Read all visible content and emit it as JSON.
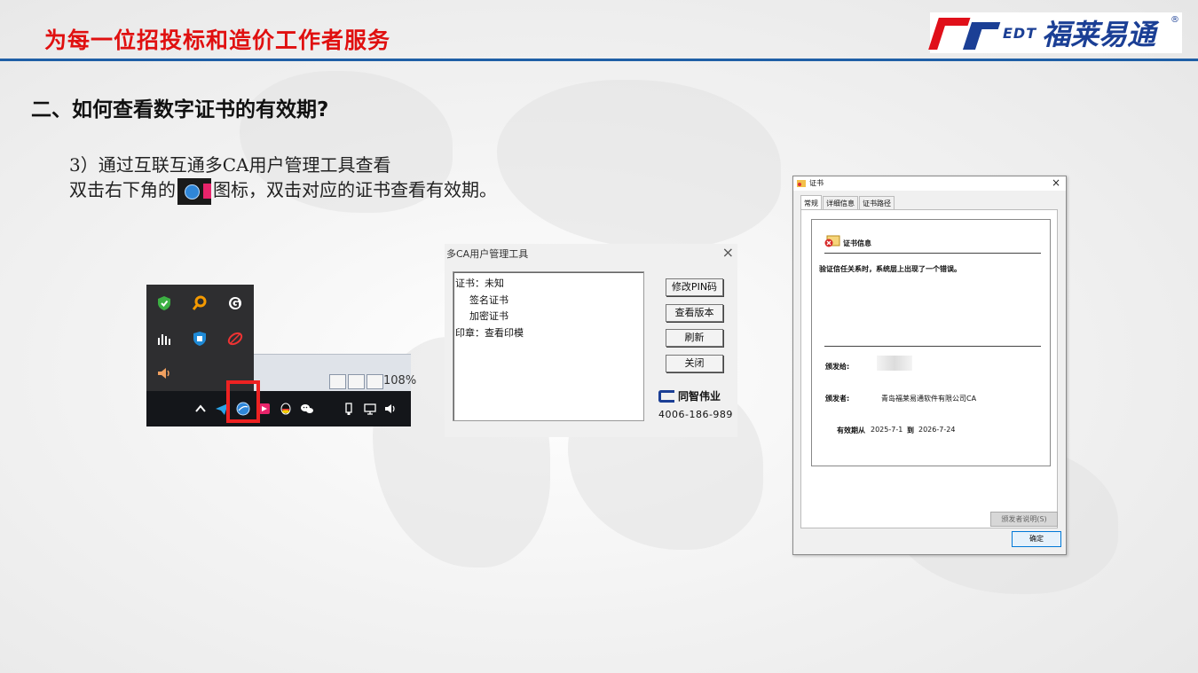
{
  "header": {
    "slogan": "为每一位招投标和造价工作者服务",
    "logo": {
      "latin": "EDT",
      "cn": "福莱易通",
      "reg": "®"
    }
  },
  "section_title": "二、如何查看数字证书的有效期?",
  "steps": {
    "line1": "3）通过互联互通多CA用户管理工具查看",
    "line2_before": "双击右下角的",
    "line2_after": "图标，双击对应的证书查看有效期。"
  },
  "taskbar_shot": {
    "zoom": "108%",
    "tray_icons": [
      "shield-icon",
      "search-icon",
      "logitech-icon",
      "audio-bars-icon",
      "defender-icon",
      "leaf-icon",
      "speaker-icon"
    ],
    "taskbar_icons": [
      "chevron-up-icon",
      "telegram-icon",
      "ca-globe-icon",
      "pink-app-icon",
      "qq-icon",
      "wechat-icon",
      "usb-icon",
      "network-icon",
      "volume-icon"
    ]
  },
  "ca_tool": {
    "title": "多CA用户管理工具",
    "close": "×",
    "tree": [
      {
        "label": "证书：未知",
        "indent": 0
      },
      {
        "label": "签名证书",
        "indent": 1
      },
      {
        "label": "加密证书",
        "indent": 1
      },
      {
        "label": "印章：查看印模",
        "indent": 0
      }
    ],
    "buttons": [
      "修改PIN码",
      "查看版本",
      "刷新",
      "关闭"
    ],
    "brand": "同智伟业",
    "phone": "4006-186-989"
  },
  "cert_dialog": {
    "title": "证书",
    "close": "×",
    "tabs": [
      "常规",
      "详细信息",
      "证书路径"
    ],
    "info_title": "证书信息",
    "error": "验证信任关系时，系统层上出现了一个错误。",
    "issued_to_label": "颁发给:",
    "issued_by_label": "颁发者:",
    "issued_by": "青岛福莱易通软件有限公司CA",
    "validity_label": "有效期从",
    "valid_from": "2025-7-1",
    "to_label": "到",
    "valid_to": "2026-7-24",
    "issuer_statement": "颁发者说明(S)",
    "ok": "确定"
  },
  "colors": {
    "slogan_red": "#e01010",
    "header_rule_blue": "#1f5fa6",
    "logo_blue": "#1b3f95",
    "highlight_red": "#ee2222"
  }
}
